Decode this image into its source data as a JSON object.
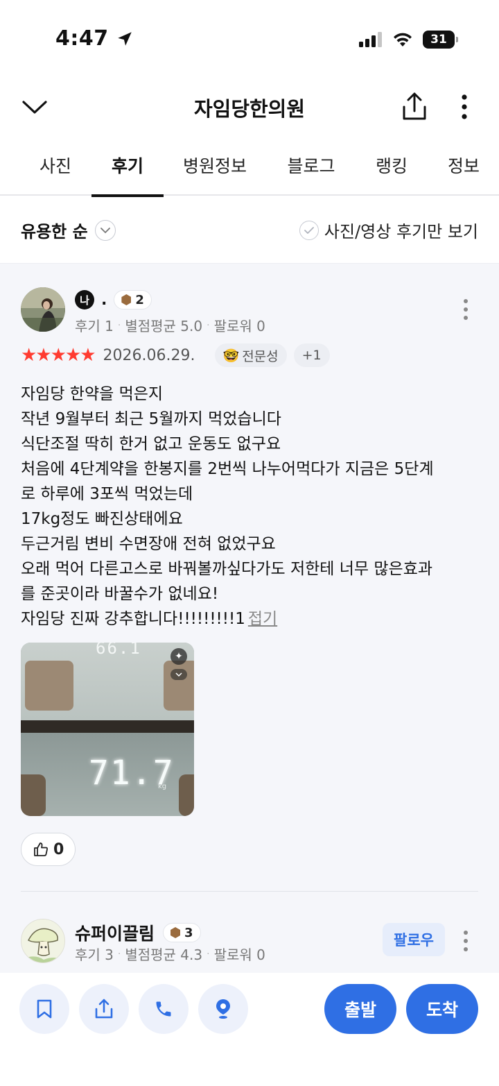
{
  "status_bar": {
    "time": "4:47",
    "battery": "31"
  },
  "header": {
    "title": "자임당한의원"
  },
  "tabs": [
    {
      "label": "사진"
    },
    {
      "label": "후기"
    },
    {
      "label": "병원정보"
    },
    {
      "label": "블로그"
    },
    {
      "label": "랭킹"
    },
    {
      "label": "정보"
    }
  ],
  "sort": {
    "label": "유용한 순",
    "photo_only_label": "사진/영상 후기만 보기"
  },
  "review1": {
    "author_initial": "나",
    "author_name": ".",
    "level": "2",
    "reviews_count": "후기 1",
    "avg_rating": "별점평균 5.0",
    "followers": "팔로워 0",
    "stars": "★★★★★",
    "date": "2026.06.29.",
    "tag": "전문성",
    "tag_emoji": "🤓",
    "extra_tags": "+1",
    "body_lines": [
      "자임당 한약을 먹은지",
      "작년 9월부터 최근 5월까지 먹었습니다",
      "식단조절 딱히 한거 없고 운동도 없구요",
      "처음에 4단계약을 한봉지를 2번씩 나누어먹다가 지금은 5단계",
      "로 하루에 3포씩 먹었는데",
      "17kg정도 빠진상태에요",
      "두근거림 변비 수면장애 전혀 없었구요",
      "오래 먹어 다른고스로 바꿔볼까싶다가도 저한테 너무 많은효과",
      "를 준곳이라 바꿀수가 없네요!",
      "자임당 진짜 강추합니다!!!!!!!!!1"
    ],
    "fold_label": "접기",
    "photo": {
      "top_reading": "66.1",
      "scale_reading": "71.7",
      "unit": "kg"
    },
    "likes": "0"
  },
  "review2": {
    "author_name": "슈퍼이끌림",
    "level": "3",
    "reviews_count": "후기 3",
    "avg_rating": "별점평균 4.3",
    "followers": "팔로워 0",
    "follow_label": "팔로우"
  },
  "bottom_bar": {
    "depart_label": "출발",
    "arrive_label": "도착"
  },
  "colors": {
    "accent": "#2f6fe4",
    "star": "#ff3b30",
    "review_bg": "#f5f6fa"
  }
}
